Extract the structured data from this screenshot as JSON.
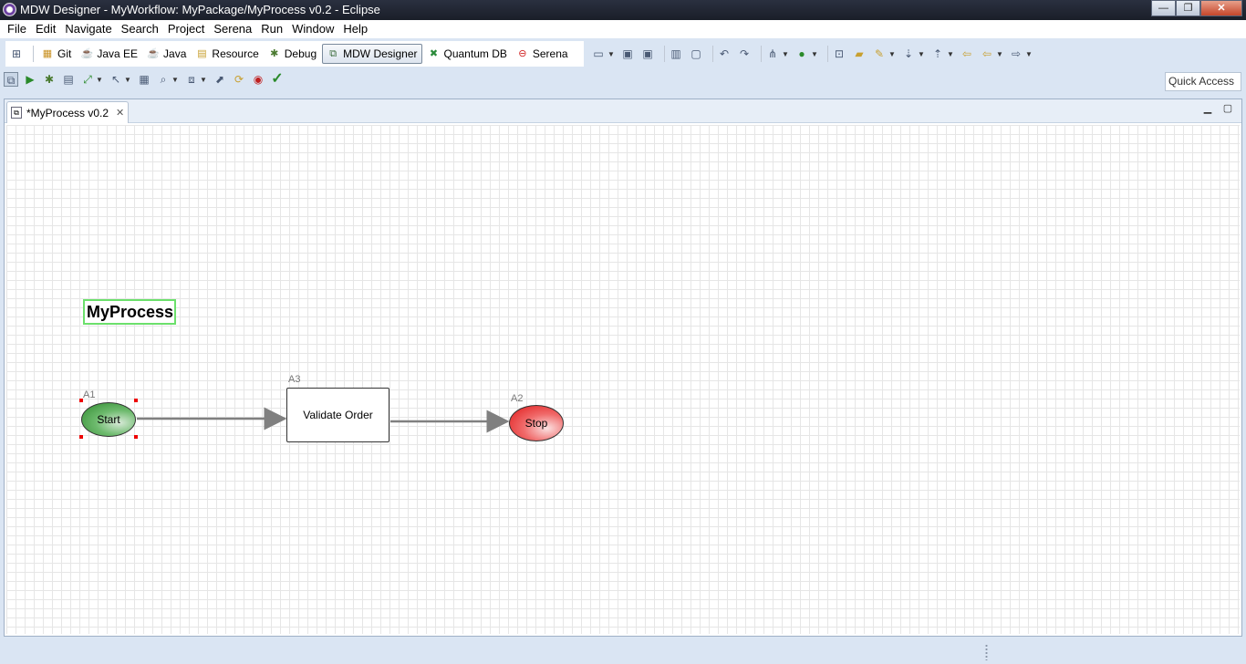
{
  "window": {
    "title": "MDW Designer - MyWorkflow: MyPackage/MyProcess v0.2 - Eclipse",
    "controls": {
      "minimize": "—",
      "maximize": "❐",
      "close": "✕"
    }
  },
  "menu": [
    "File",
    "Edit",
    "Navigate",
    "Search",
    "Project",
    "Serena",
    "Run",
    "Window",
    "Help"
  ],
  "perspectives": [
    {
      "label": "Git",
      "icon": "git-icon"
    },
    {
      "label": "Java EE",
      "icon": "java-ee-icon"
    },
    {
      "label": "Java",
      "icon": "java-icon"
    },
    {
      "label": "Resource",
      "icon": "resource-icon"
    },
    {
      "label": "Debug",
      "icon": "debug-icon"
    },
    {
      "label": "MDW Designer",
      "icon": "mdw-designer-icon",
      "active": true
    },
    {
      "label": "Quantum DB",
      "icon": "quantum-db-icon"
    },
    {
      "label": "Serena",
      "icon": "serena-icon"
    }
  ],
  "quick_access": {
    "placeholder": "Quick Access"
  },
  "editor": {
    "tab_label": "*MyProcess v0.2",
    "process_name": "MyProcess",
    "nodes": {
      "start": {
        "id": "A1",
        "label": "Start"
      },
      "task": {
        "id": "A3",
        "label": "Validate Order"
      },
      "stop": {
        "id": "A2",
        "label": "Stop"
      }
    }
  },
  "colors": {
    "start_fill": "#3a9a3a",
    "stop_fill": "#e82020",
    "title_border": "#6ce06c",
    "selection_handle": "#ee0000",
    "link": "#808080"
  }
}
